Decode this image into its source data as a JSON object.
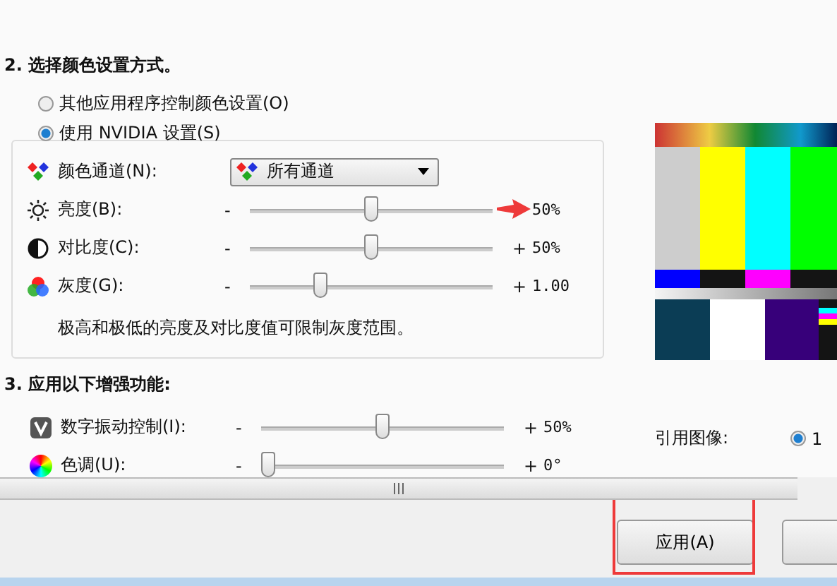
{
  "section2": {
    "heading": "2. 选择颜色设置方式。",
    "options": [
      {
        "label": "其他应用程序控制颜色设置(O)",
        "selected": false
      },
      {
        "label": "使用 NVIDIA 设置(S)",
        "selected": true
      }
    ]
  },
  "color_channel": {
    "label": "颜色通道(N):",
    "value": "所有通道"
  },
  "adjustments": [
    {
      "kind": "brightness",
      "label": "亮度(B):",
      "minus": "-",
      "level": 0.5,
      "reading": "50%",
      "annotated": true
    },
    {
      "kind": "contrast",
      "label": "对比度(C):",
      "minus": "-",
      "plus": "+",
      "level": 0.5,
      "reading": "50%",
      "annotated": false
    },
    {
      "kind": "gamma",
      "label": "灰度(G):",
      "minus": "-",
      "plus": "+",
      "level": 0.29,
      "reading": "1.00",
      "annotated": false
    }
  ],
  "note": "极高和极低的亮度及对比度值可限制灰度范围。",
  "section3": {
    "heading": "3. 应用以下增强功能:",
    "adjustments": [
      {
        "kind": "vibrance",
        "label": "数字振动控制(I):",
        "minus": "-",
        "plus": "+",
        "level": 0.5,
        "reading": "50%",
        "annotated": false
      },
      {
        "kind": "hue",
        "label": "色调(U):",
        "minus": "-",
        "plus": "+",
        "level": 0.03,
        "reading": "0°",
        "annotated": false
      }
    ]
  },
  "reference_image": {
    "label": "引用图像:",
    "options": [
      {
        "label": "1",
        "selected": true
      }
    ]
  },
  "buttons": [
    {
      "label": "应用(A)",
      "highlighted": true
    },
    {
      "highlighted": false
    }
  ]
}
